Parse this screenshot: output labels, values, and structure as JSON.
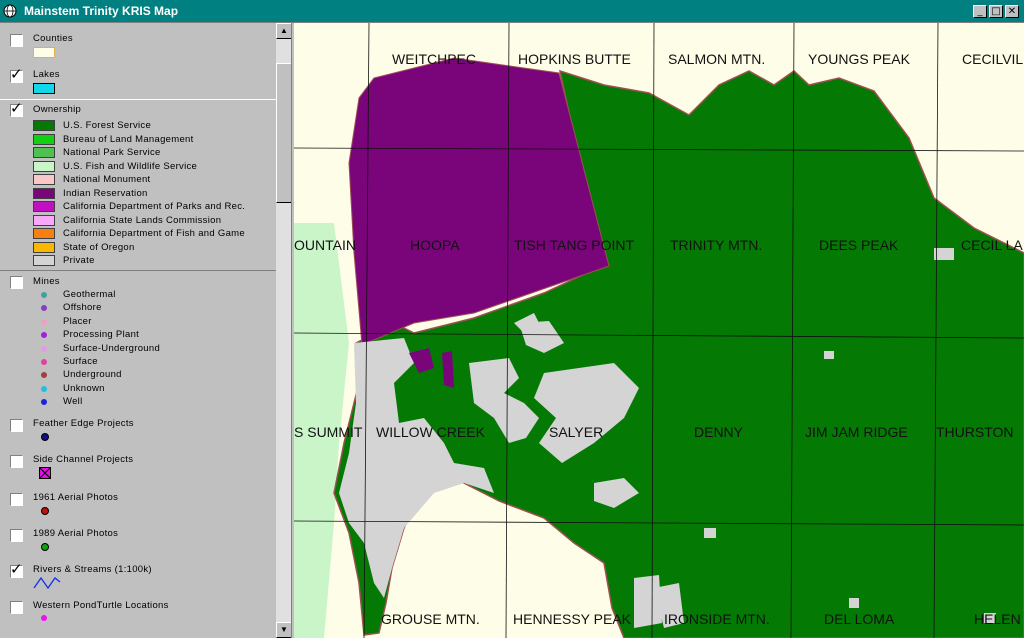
{
  "window": {
    "title": "Mainstem Trinity KRIS Map",
    "minimize": "_",
    "maximize": "□",
    "close": "✕"
  },
  "colors": {
    "titlebar": "#008080",
    "forest_service": "#047a04",
    "indian_reservation": "#7a057a",
    "private": "#d4d4d4",
    "fish_wildlife": "#c9f5c9",
    "background": "#fefde8",
    "boundary": "#9c5050"
  },
  "legend": {
    "counties": {
      "label": "Counties",
      "checked": false
    },
    "lakes": {
      "label": "Lakes",
      "checked": true
    },
    "ownership": {
      "label": "Ownership",
      "checked": true,
      "items": [
        {
          "label": "U.S. Forest Service",
          "color": "#047a04"
        },
        {
          "label": "Bureau of Land Management",
          "color": "#10d010"
        },
        {
          "label": "National Park Service",
          "color": "#50c050"
        },
        {
          "label": "U.S. Fish and Wildlife Service",
          "color": "#c9f5c9"
        },
        {
          "label": "National Monument",
          "color": "#f8c8c8"
        },
        {
          "label": "Indian Reservation",
          "color": "#7a057a"
        },
        {
          "label": "California Department of Parks and Rec.",
          "color": "#c010c0"
        },
        {
          "label": "California State Lands Commission",
          "color": "#f8a8f8"
        },
        {
          "label": "California Department of Fish and Game",
          "color": "#f88010"
        },
        {
          "label": "State of Oregon",
          "color": "#f8b800"
        },
        {
          "label": "Private",
          "color": "#d4d4d4"
        }
      ]
    },
    "mines": {
      "label": "Mines",
      "checked": false,
      "items": [
        {
          "label": "Geothermal",
          "color": "#40a0a0"
        },
        {
          "label": "Offshore",
          "color": "#8040c0"
        },
        {
          "label": "Placer",
          "color": "#f0a0c0"
        },
        {
          "label": "Processing Plant",
          "color": "#a020e0"
        },
        {
          "label": "Surface-Underground",
          "color": "#e0a0e0"
        },
        {
          "label": "Surface",
          "color": "#e040a0"
        },
        {
          "label": "Underground",
          "color": "#a04040"
        },
        {
          "label": "Unknown",
          "color": "#20c0e0"
        },
        {
          "label": "Well",
          "color": "#2020e0"
        }
      ]
    },
    "feather_edge": {
      "label": "Feather Edge Projects",
      "checked": false
    },
    "side_channel": {
      "label": "Side Channel Projects",
      "checked": false
    },
    "aerial_1961": {
      "label": "1961 Aerial Photos",
      "checked": false
    },
    "aerial_1989": {
      "label": "1989 Aerial Photos",
      "checked": false
    },
    "rivers": {
      "label": "Rivers & Streams (1:100k)",
      "checked": true
    },
    "pondturtle": {
      "label": "Western PondTurtle Locations",
      "checked": false
    }
  },
  "map": {
    "quad_labels": [
      "WEITCHPEC",
      "HOPKINS BUTTE",
      "SALMON MTN.",
      "YOUNGS PEAK",
      "CECILVIL",
      "OUNTAIN",
      "HOOPA",
      "TISH TANG POINT",
      "TRINITY MTN.",
      "DEES PEAK",
      "CECIL LA",
      "S SUMMIT",
      "WILLOW CREEK",
      "SALYER",
      "DENNY",
      "JIM JAM RIDGE",
      "THURSTON",
      "GROUSE MTN.",
      "HENNESSY PEAK",
      "IRONSIDE MTN.",
      "DEL LOMA",
      "HELEN"
    ]
  }
}
